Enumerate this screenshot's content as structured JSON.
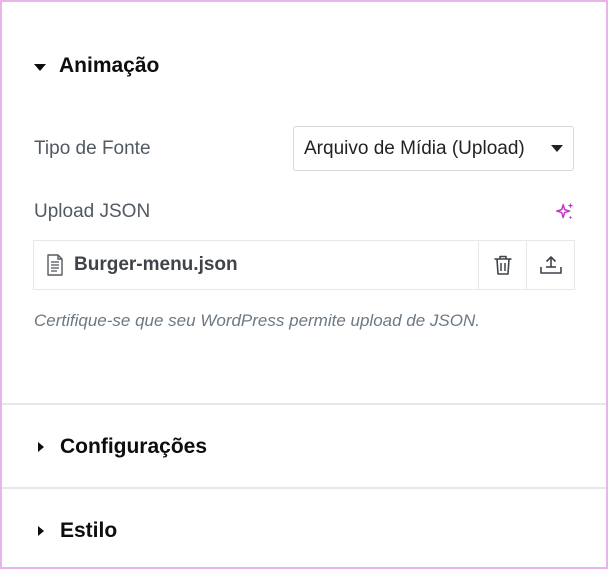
{
  "sections": {
    "animation": {
      "title": "Animação",
      "font_type_label": "Tipo de Fonte",
      "font_type_value": "Arquivo de Mídia (Upload)",
      "upload_label": "Upload JSON",
      "file_name": "Burger-menu.json",
      "help_text": "Certifique-se que seu WordPress permite upload de JSON."
    },
    "settings": {
      "title": "Configurações"
    },
    "style": {
      "title": "Estilo"
    }
  },
  "colors": {
    "frame_border": "#e8b4ea",
    "ai_accent": "#c036c4",
    "label": "#515962",
    "help": "#6d7882"
  },
  "icons": {
    "ai": "sparkles-icon",
    "file": "document-icon",
    "delete": "trash-icon",
    "upload": "upload-icon"
  }
}
